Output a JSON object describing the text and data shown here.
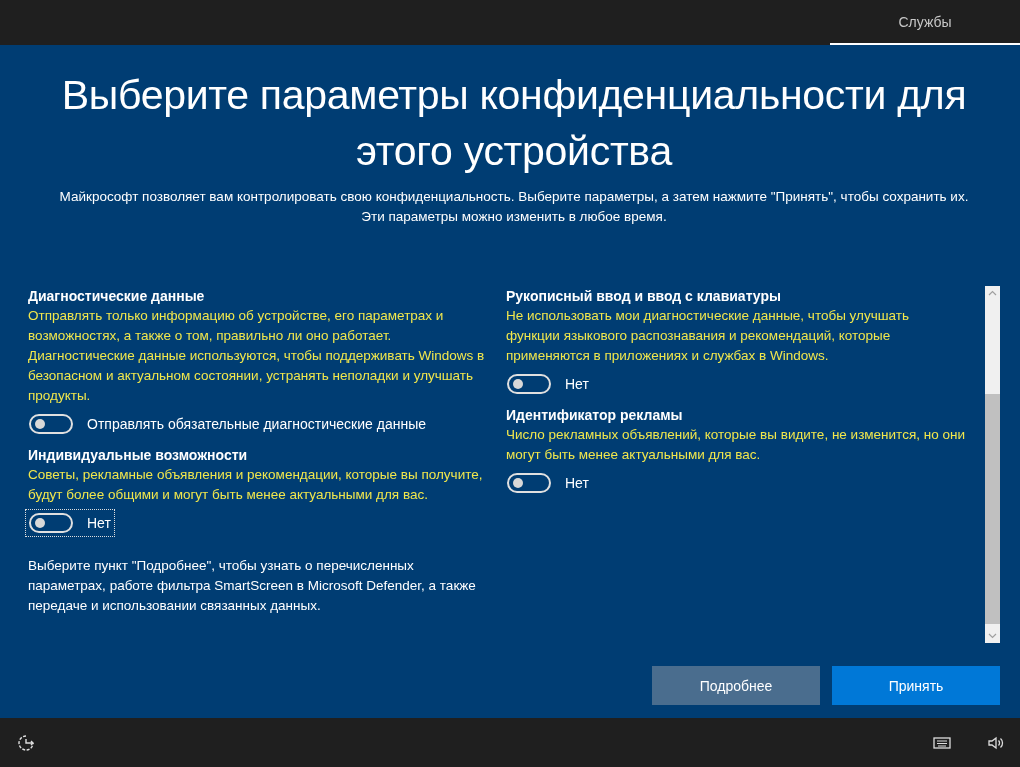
{
  "top_bar": {
    "tab": {
      "label": "Службы",
      "selected": true
    }
  },
  "title": "Выберите параметры конфиденциальности для этого устройства",
  "subtitle": "Майкрософт позволяет вам контролировать свою конфиденциальность. Выберите параметры, а затем нажмите \"Принять\", чтобы сохранить их. Эти параметры можно изменить в любое время.",
  "columns": [
    {
      "sections": [
        {
          "heading": "Диагностические данные",
          "description": "Отправлять только информацию об устройстве, его параметрах и возможностях, а также о том, правильно ли оно работает. Диагностические данные используются, чтобы поддерживать Windows в безопасном и актуальном состоянии, устранять неполадки и улучшать продукты.",
          "toggle": {
            "on": false,
            "focused": false,
            "label": "Отправлять обязательные диагностические данные"
          }
        },
        {
          "heading": "Индивидуальные возможности",
          "description": "Советы, рекламные объявления и рекомендации, которые вы получите, будут более общими и могут быть менее актуальными для вас.",
          "toggle": {
            "on": false,
            "focused": true,
            "label": "Нет"
          }
        }
      ],
      "note": "Выберите пункт \"Подробнее\", чтобы узнать о перечисленных параметрах, работе фильтра SmartScreen в Microsoft Defender, а также передаче и использовании связанных данных."
    },
    {
      "sections": [
        {
          "heading": "Рукописный ввод и ввод с клавиатуры",
          "description": "Не использовать мои диагностические данные, чтобы улучшать функции языкового распознавания и рекомендаций, которые применяются в приложениях и службах в Windows.",
          "toggle": {
            "on": false,
            "focused": false,
            "label": "Нет"
          }
        },
        {
          "heading": "Идентификатор рекламы",
          "description": "Число рекламных объявлений, которые вы видите, не изменится, но они могут быть менее актуальными для вас.",
          "toggle": {
            "on": false,
            "focused": false,
            "label": "Нет"
          }
        }
      ]
    }
  ],
  "buttons": [
    {
      "label": "Подробнее",
      "kind": "secondary"
    },
    {
      "label": "Принять",
      "kind": "primary"
    }
  ]
}
